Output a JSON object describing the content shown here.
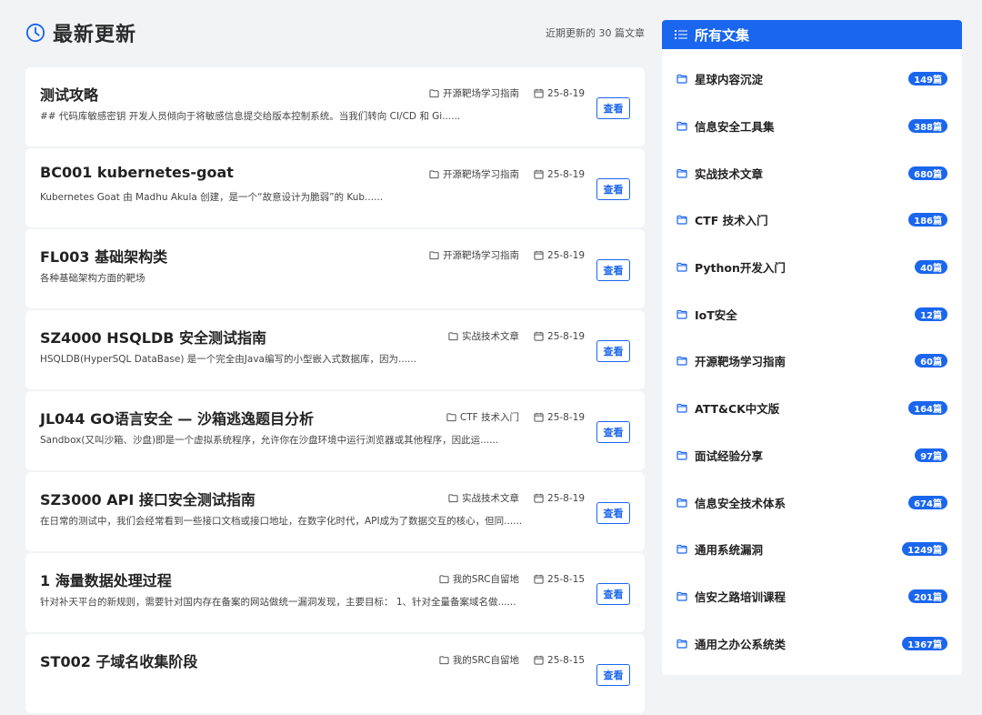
{
  "header": {
    "title": "最新更新",
    "recent_count": "近期更新的 30 篇文章"
  },
  "articles": [
    {
      "title": "测试攻略",
      "excerpt": "## 代码库敏感密钥 开发人员倾向于将敏感信息提交给版本控制系统。当我们转向 CI/CD 和 Gi......",
      "category": "开源靶场学习指南",
      "date": "25-8-19",
      "view": "查看"
    },
    {
      "title": "BC001 kubernetes-goat",
      "excerpt": "Kubernetes Goat 由 Madhu Akula 创建，是一个“故意设计为脆弱”的 Kub......",
      "category": "开源靶场学习指南",
      "date": "25-8-19",
      "view": "查看"
    },
    {
      "title": "FL003 基础架构类",
      "excerpt": "各种基础架构方面的靶场",
      "category": "开源靶场学习指南",
      "date": "25-8-19",
      "view": "查看"
    },
    {
      "title": "SZ4000 HSQLDB 安全测试指南",
      "excerpt": "HSQLDB(HyperSQL DataBase) 是一个完全由Java编写的小型嵌入式数据库，因为......",
      "category": "实战技术文章",
      "date": "25-8-19",
      "view": "查看"
    },
    {
      "title": "JL044 GO语言安全 — 沙箱逃逸题目分析",
      "excerpt": "Sandbox(又叫沙箱、沙盘)即是一个虚拟系统程序，允许你在沙盘环境中运行浏览器或其他程序，因此运......",
      "category": "CTF 技术入门",
      "date": "25-8-19",
      "view": "查看"
    },
    {
      "title": "SZ3000 API 接口安全测试指南",
      "excerpt": "在日常的测试中，我们会经常看到一些接口文档或接口地址，在数字化时代，API成为了数据交互的核心，但同......",
      "category": "实战技术文章",
      "date": "25-8-19",
      "view": "查看"
    },
    {
      "title": "1 海量数据处理过程",
      "excerpt": "针对补天平台的新规则，需要针对国内存在备案的网站做统一漏洞发现，主要目标： 1、针对全量备案域名做......",
      "category": "我的SRC自留地",
      "date": "25-8-15",
      "view": "查看"
    },
    {
      "title": "ST002 子域名收集阶段",
      "excerpt": "",
      "category": "我的SRC自留地",
      "date": "25-8-15",
      "view": "查看"
    }
  ],
  "sidebar": {
    "title": "所有文集",
    "items": [
      {
        "label": "星球内容沉淀",
        "count": "149篇"
      },
      {
        "label": "信息安全工具集",
        "count": "388篇"
      },
      {
        "label": "实战技术文章",
        "count": "680篇"
      },
      {
        "label": "CTF 技术入门",
        "count": "186篇"
      },
      {
        "label": "Python开发入门",
        "count": "40篇"
      },
      {
        "label": "IoT安全",
        "count": "12篇"
      },
      {
        "label": "开源靶场学习指南",
        "count": "60篇"
      },
      {
        "label": "ATT&CK中文版",
        "count": "164篇"
      },
      {
        "label": "面试经验分享",
        "count": "97篇"
      },
      {
        "label": "信息安全技术体系",
        "count": "674篇"
      },
      {
        "label": "通用系统漏洞",
        "count": "1249篇"
      },
      {
        "label": "信安之路培训课程",
        "count": "201篇"
      },
      {
        "label": "通用之办公系统类",
        "count": "1367篇"
      }
    ]
  },
  "colors": {
    "accent": "#1a66ee",
    "background": "#f1f3f5"
  }
}
